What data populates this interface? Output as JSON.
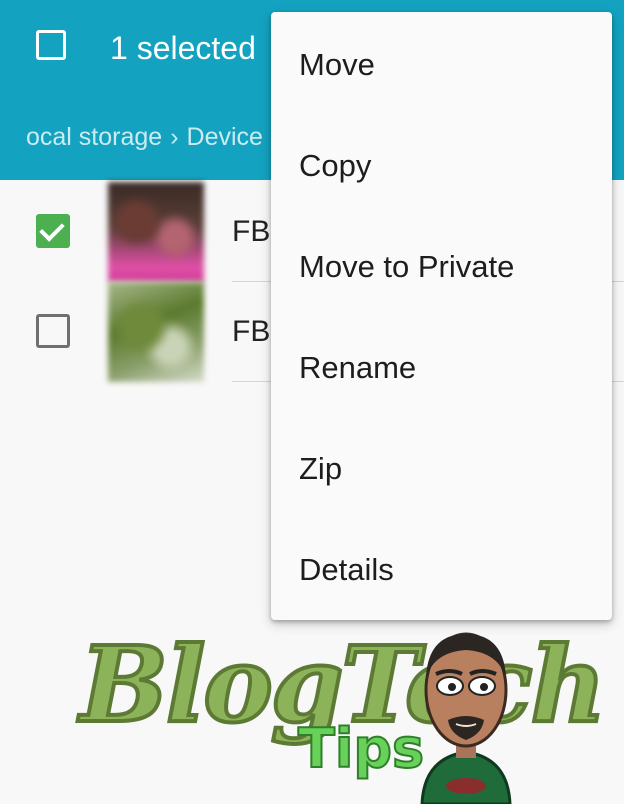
{
  "app_bar": {
    "selected_label": "1 selected",
    "breadcrumb": [
      "ocal storage",
      "Device"
    ],
    "breadcrumb_separator": "›",
    "background_color": "#13a3c0"
  },
  "files": [
    {
      "name": "FB",
      "checked": true
    },
    {
      "name": "FB",
      "checked": false
    }
  ],
  "menu": {
    "items": [
      "Move",
      "Copy",
      "Move to Private",
      "Rename",
      "Zip",
      "Details"
    ]
  },
  "watermark": {
    "text": "BlogTech",
    "subtext": "Tips"
  },
  "colors": {
    "checkbox_checked": "#4caf50",
    "menu_background": "#fafafa",
    "text_primary": "#222222"
  }
}
